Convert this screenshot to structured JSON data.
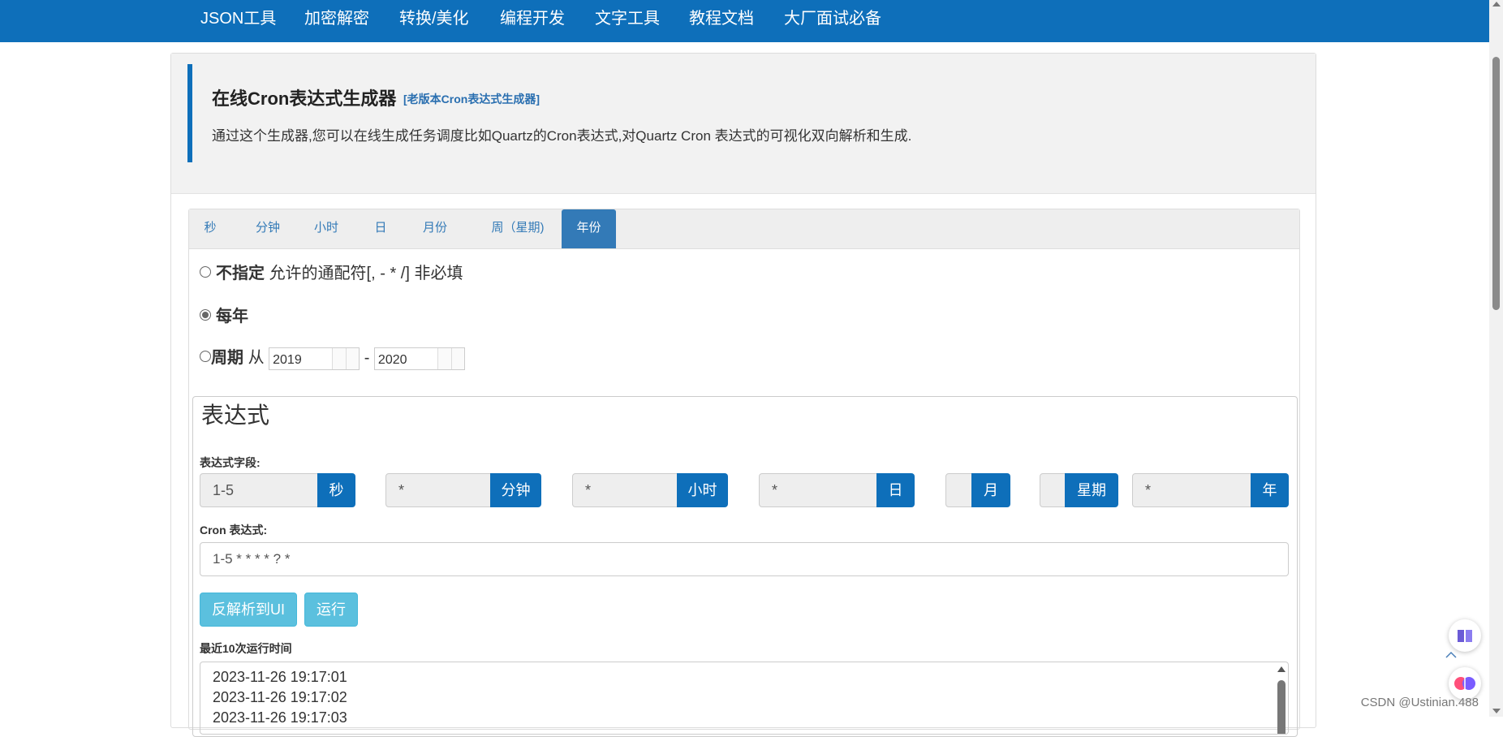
{
  "nav": {
    "items": [
      "JSON工具",
      "加密解密",
      "转换/美化",
      "编程开发",
      "文字工具",
      "教程文档",
      "大厂面试必备"
    ]
  },
  "hero": {
    "title": "在线Cron表达式生成器",
    "old_link": "[老版本Cron表达式生成器]",
    "description": "通过这个生成器,您可以在线生成任务调度比如Quartz的Cron表达式,对Quartz Cron 表达式的可视化双向解析和生成."
  },
  "tabs": [
    {
      "label": "秒",
      "active": false
    },
    {
      "label": "分钟",
      "active": false
    },
    {
      "label": "小时",
      "active": false
    },
    {
      "label": "日",
      "active": false
    },
    {
      "label": "月份",
      "active": false
    },
    {
      "label": "周（星期)",
      "active": false
    },
    {
      "label": "年份",
      "active": true
    }
  ],
  "options": {
    "unspecified": {
      "label": "不指定",
      "hint": "允许的通配符[, - * /] 非必填",
      "checked": false
    },
    "every_year": {
      "label": "每年",
      "checked": true
    },
    "period": {
      "label": "周期",
      "from_label": "从",
      "from_value": "2019",
      "separator": "-",
      "to_value": "2020",
      "checked": false
    }
  },
  "expression": {
    "legend": "表达式",
    "fields_label": "表达式字段:",
    "fields": [
      {
        "value": "1-5",
        "unit": "秒"
      },
      {
        "value": "*",
        "unit": "分钟"
      },
      {
        "value": "*",
        "unit": "小时"
      },
      {
        "value": "*",
        "unit": "日"
      },
      {
        "value": "",
        "unit": "月"
      },
      {
        "value": "",
        "unit": "星期"
      },
      {
        "value": "*",
        "unit": "年"
      }
    ],
    "cron_label": "Cron 表达式:",
    "cron_value": "1-5 * * * * ? *",
    "parse_button": "反解析到UI",
    "run_button": "运行",
    "recent_label": "最近10次运行时间",
    "recent_runs": [
      "2023-11-26 19:17:01",
      "2023-11-26 19:17:02",
      "2023-11-26 19:17:03"
    ]
  },
  "watermark": "CSDN @Ustinian.488",
  "colors": {
    "nav_bg": "#0e6fba",
    "tab_active": "#337ab7",
    "info_button": "#5bc0de"
  },
  "icons": [
    "book-icon",
    "brain-icon",
    "scroll-top-icon"
  ]
}
